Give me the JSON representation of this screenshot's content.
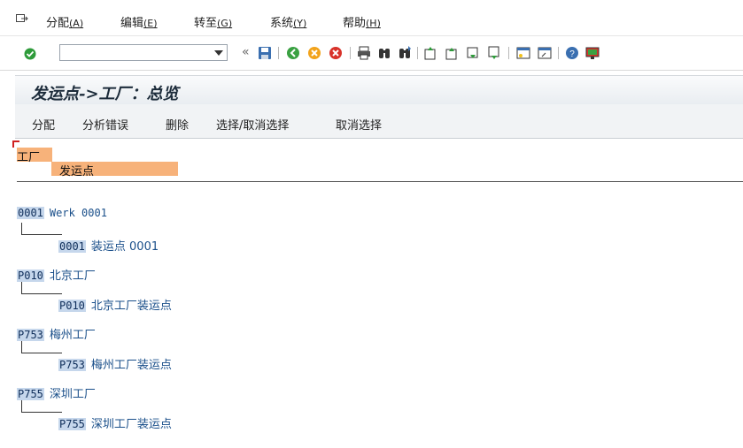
{
  "menu": [
    {
      "label": "分配",
      "accel": "(A)"
    },
    {
      "label": "编辑",
      "accel": "(E)"
    },
    {
      "label": "转至",
      "accel": "(G)"
    },
    {
      "label": "系统",
      "accel": "(Y)"
    },
    {
      "label": "帮助",
      "accel": "(H)"
    }
  ],
  "toolbar": {
    "command_value": "",
    "icons": [
      "enter-icon",
      "back-nav-icon",
      "save-icon",
      "back-icon",
      "exit-icon",
      "cancel-icon",
      "print-icon",
      "find-icon",
      "find-next-icon",
      "first-page-icon",
      "prev-page-icon",
      "next-page-icon",
      "last-page-icon",
      "new-session-icon",
      "shortcut-icon",
      "help-icon",
      "customize-icon"
    ]
  },
  "title": "发运点->工厂：总览",
  "app_buttons": [
    "分配",
    "分析错误",
    "删除",
    "选择/取消选择",
    "取消选择"
  ],
  "headers": {
    "plant": "工厂",
    "shipping_point": "发运点"
  },
  "plants": [
    {
      "code": "0001",
      "name": "Werk 0001",
      "sp_code": "0001",
      "sp_name": "装运点 0001"
    },
    {
      "code": "P010",
      "name": "北京工厂",
      "sp_code": "P010",
      "sp_name": "北京工厂装运点"
    },
    {
      "code": "P753",
      "name": "梅州工厂",
      "sp_code": "P753",
      "sp_name": "梅州工厂装运点"
    },
    {
      "code": "P755",
      "name": "深圳工厂",
      "sp_code": "P755",
      "sp_name": "深圳工厂装运点"
    }
  ]
}
